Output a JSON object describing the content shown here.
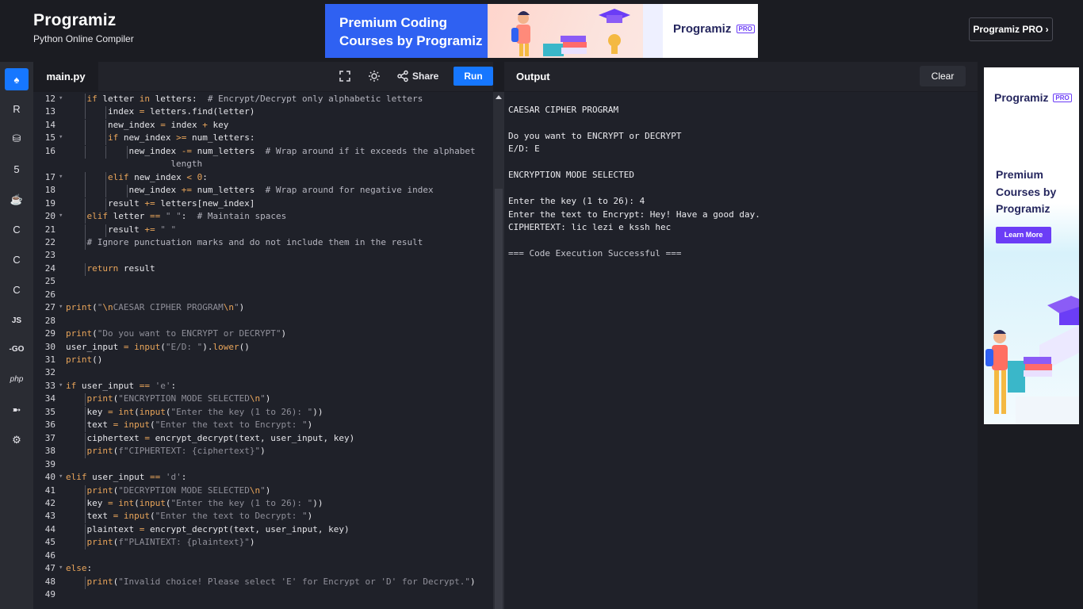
{
  "header": {
    "logo": "Programiz",
    "subtitle": "Python Online Compiler",
    "banner": {
      "headline_line1": "Premium Coding",
      "headline_line2": "Courses by Programiz",
      "logo": "Programiz",
      "badge": "PRO"
    },
    "pro_button": "Programiz PRO ›"
  },
  "sidebar": {
    "languages": [
      {
        "name": "python",
        "icon": "python-icon",
        "glyph": "♠",
        "active": true
      },
      {
        "name": "r",
        "icon": "r-icon",
        "glyph": "R"
      },
      {
        "name": "sql",
        "icon": "database-icon",
        "glyph": "⛁"
      },
      {
        "name": "html",
        "icon": "html5-icon",
        "glyph": "5"
      },
      {
        "name": "java",
        "icon": "java-icon",
        "glyph": "☕"
      },
      {
        "name": "c",
        "icon": "c-icon",
        "glyph": "C"
      },
      {
        "name": "cpp",
        "icon": "cpp-icon",
        "glyph": "C"
      },
      {
        "name": "csharp",
        "icon": "csharp-icon",
        "glyph": "C"
      },
      {
        "name": "javascript",
        "icon": "javascript-icon",
        "label": "JS"
      },
      {
        "name": "go",
        "icon": "go-icon",
        "label": "-GO"
      },
      {
        "name": "php",
        "icon": "php-icon",
        "label": "php"
      },
      {
        "name": "swift",
        "icon": "swift-icon",
        "glyph": "➼"
      },
      {
        "name": "rust",
        "icon": "rust-icon",
        "glyph": "⚙"
      }
    ]
  },
  "editor": {
    "tab": "main.py",
    "share_label": "Share",
    "run_label": "Run"
  },
  "output": {
    "title": "Output",
    "clear_label": "Clear",
    "lines": [
      "CAESAR CIPHER PROGRAM",
      "",
      "Do you want to ENCRYPT or DECRYPT",
      "E/D: E",
      "",
      "ENCRYPTION MODE SELECTED",
      "",
      "Enter the key (1 to 26): 4",
      "Enter the text to Encrypt: Hey! Have a good day.",
      "CIPHERTEXT: lic lezi e kssh hec",
      "",
      "=== Code Execution Successful ==="
    ]
  },
  "code_lines": [
    {
      "n": "12",
      "text": "    if letter in letters:  # Encrypt/Decrypt only alphabetic letters"
    },
    {
      "n": "13",
      "text": "        index = letters.find(letter)"
    },
    {
      "n": "14",
      "text": "        new_index = index + key"
    },
    {
      "n": "15",
      "text": "        if new_index >= num_letters:"
    },
    {
      "n": "16",
      "text": "            new_index -= num_letters  # Wrap around if it exceeds the alphabet",
      "cont": "length"
    },
    {
      "n": "17",
      "text": "        elif new_index < 0:"
    },
    {
      "n": "18",
      "text": "            new_index += num_letters  # Wrap around for negative index"
    },
    {
      "n": "19",
      "text": "        result += letters[new_index]"
    },
    {
      "n": "20",
      "text": "    elif letter == \" \":  # Maintain spaces"
    },
    {
      "n": "21",
      "text": "        result += \" \""
    },
    {
      "n": "22",
      "text": "    # Ignore punctuation marks and do not include them in the result"
    },
    {
      "n": "23",
      "text": ""
    },
    {
      "n": "24",
      "text": "    return result"
    },
    {
      "n": "25",
      "text": ""
    },
    {
      "n": "26",
      "text": ""
    },
    {
      "n": "27",
      "text": "print(\"\\nCAESAR CIPHER PROGRAM\\n\")"
    },
    {
      "n": "28",
      "text": ""
    },
    {
      "n": "29",
      "text": "print(\"Do you want to ENCRYPT or DECRYPT\")"
    },
    {
      "n": "30",
      "text": "user_input = input(\"E/D: \").lower()"
    },
    {
      "n": "31",
      "text": "print()"
    },
    {
      "n": "32",
      "text": ""
    },
    {
      "n": "33",
      "text": "if user_input == 'e':"
    },
    {
      "n": "34",
      "text": "    print(\"ENCRYPTION MODE SELECTED\\n\")"
    },
    {
      "n": "35",
      "text": "    key = int(input(\"Enter the key (1 to 26): \"))"
    },
    {
      "n": "36",
      "text": "    text = input(\"Enter the text to Encrypt: \")"
    },
    {
      "n": "37",
      "text": "    ciphertext = encrypt_decrypt(text, user_input, key)"
    },
    {
      "n": "38",
      "text": "    print(f\"CIPHERTEXT: {ciphertext}\")"
    },
    {
      "n": "39",
      "text": ""
    },
    {
      "n": "40",
      "text": "elif user_input == 'd':"
    },
    {
      "n": "41",
      "text": "    print(\"DECRYPTION MODE SELECTED\\n\")"
    },
    {
      "n": "42",
      "text": "    key = int(input(\"Enter the key (1 to 26): \"))"
    },
    {
      "n": "43",
      "text": "    text = input(\"Enter the text to Decrypt: \")"
    },
    {
      "n": "44",
      "text": "    plaintext = encrypt_decrypt(text, user_input, key)"
    },
    {
      "n": "45",
      "text": "    print(f\"PLAINTEXT: {plaintext}\")"
    },
    {
      "n": "46",
      "text": ""
    },
    {
      "n": "47",
      "text": "else:"
    },
    {
      "n": "48",
      "text": "    print(\"Invalid choice! Please select 'E' for Encrypt or 'D' for Decrypt.\")"
    },
    {
      "n": "49",
      "text": ""
    }
  ],
  "ad": {
    "logo": "Programiz",
    "badge": "PRO",
    "headline": "Premium Courses by Programiz",
    "button": "Learn More"
  },
  "colors": {
    "accent": "#1677ff",
    "editor_bg": "#1f2129",
    "keyword": "#e9a55a",
    "string": "#8f8f99",
    "ad_button": "#6b3df6"
  }
}
